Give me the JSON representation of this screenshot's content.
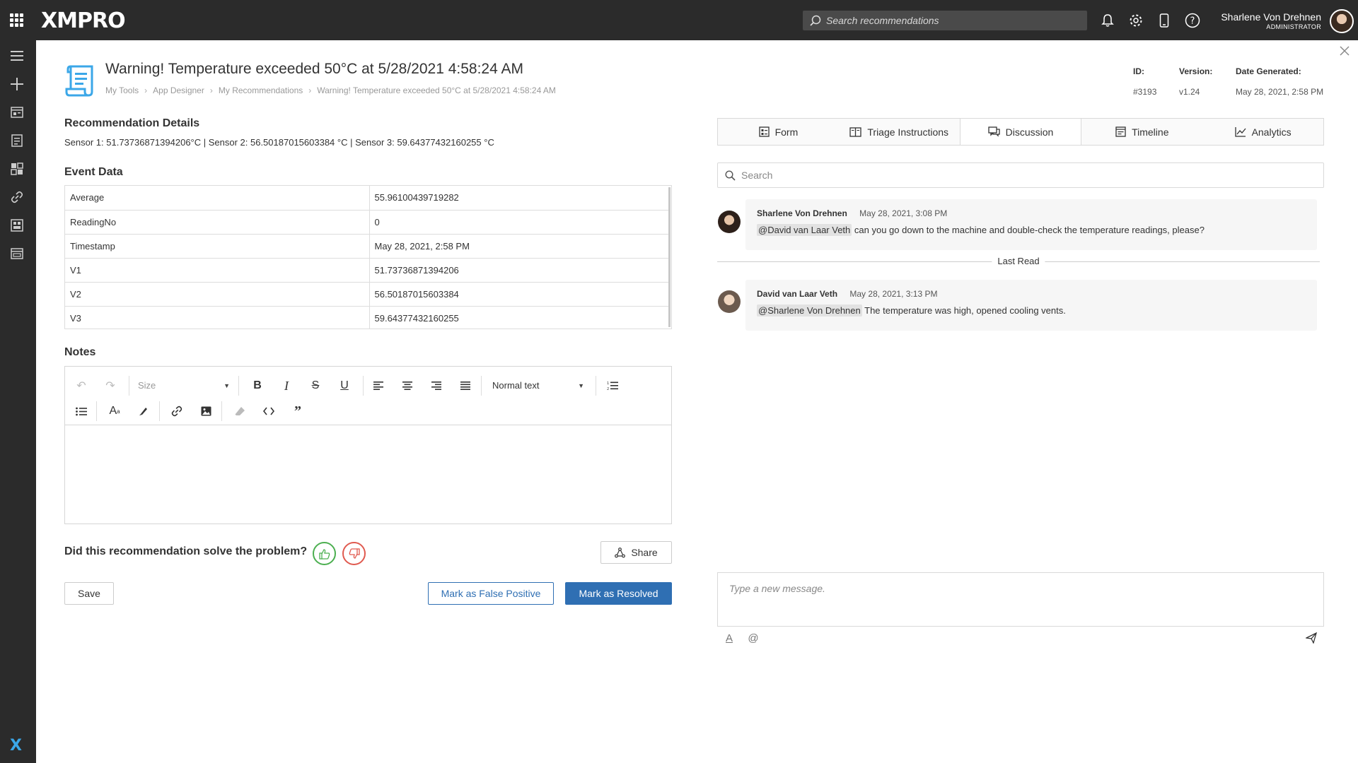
{
  "app": {
    "logo": "XMPRO"
  },
  "topbar": {
    "search_placeholder": "Search recommendations",
    "user_name": "Sharlene Von Drehnen",
    "user_role": "ADMINISTRATOR"
  },
  "header": {
    "title": "Warning! Temperature exceeded 50°C at 5/28/2021 4:58:24 AM",
    "breadcrumb": [
      "My Tools",
      "App Designer",
      "My Recommendations",
      "Warning! Temperature exceeded 50°C at 5/28/2021 4:58:24 AM"
    ],
    "meta": {
      "id_label": "ID:",
      "id_value": "#3193",
      "version_label": "Version:",
      "version_value": "v1.24",
      "date_label": "Date Generated:",
      "date_value": "May 28, 2021, 2:58 PM"
    }
  },
  "details": {
    "heading": "Recommendation Details",
    "text": "Sensor 1: 51.73736871394206°C | Sensor 2: 56.50187015603384 °C | Sensor 3: 59.64377432160255 °C"
  },
  "event_data": {
    "heading": "Event Data",
    "rows": [
      {
        "key": "Average",
        "value": "55.96100439719282"
      },
      {
        "key": "ReadingNo",
        "value": "0"
      },
      {
        "key": "Timestamp",
        "value": "May 28, 2021, 2:58 PM"
      },
      {
        "key": "V1",
        "value": "51.73736871394206"
      },
      {
        "key": "V2",
        "value": "56.50187015603384"
      },
      {
        "key": "V3",
        "value": "59.64377432160255"
      }
    ]
  },
  "notes": {
    "heading": "Notes",
    "size_select": "Size",
    "format_select": "Normal text"
  },
  "feedback": {
    "question": "Did this recommendation solve the problem?"
  },
  "actions": {
    "share": "Share",
    "save": "Save",
    "false_positive": "Mark as False Positive",
    "resolved": "Mark as Resolved"
  },
  "tabs": [
    "Form",
    "Triage Instructions",
    "Discussion",
    "Timeline",
    "Analytics"
  ],
  "discussion": {
    "search_placeholder": "Search",
    "messages": [
      {
        "author": "Sharlene Von Drehnen",
        "time": "May 28, 2021, 3:08 PM",
        "mention": "@David van Laar Veth",
        "text": " can you go down to the machine and double-check the temperature readings, please?"
      },
      {
        "author": "David van Laar Veth",
        "time": "May 28, 2021, 3:13 PM",
        "mention": "@Sharlene Von Drehnen",
        "text": " The temperature was high, opened cooling vents."
      }
    ],
    "last_read": "Last Read",
    "compose_placeholder": "Type a new message."
  },
  "colors": {
    "primary": "#2f6fb3",
    "topbar": "#2b2b2b",
    "icon_blue": "#3ba7e8",
    "like": "#4caf50",
    "dislike": "#e05a4f"
  }
}
